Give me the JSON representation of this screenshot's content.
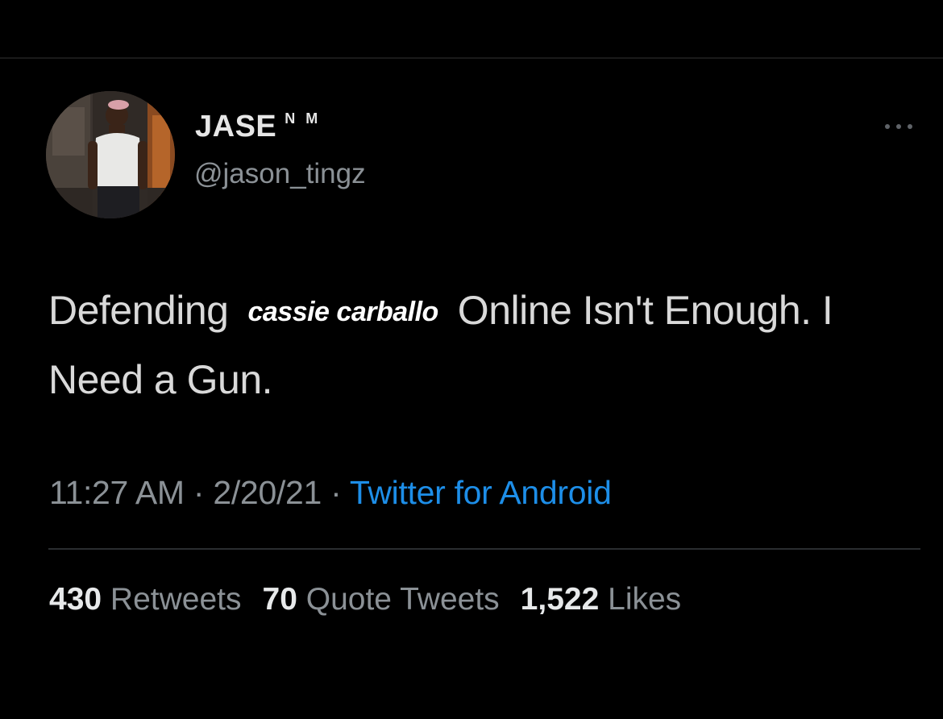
{
  "tweet": {
    "author": {
      "display_name": "JASE",
      "name_suffix": "N M",
      "handle": "@jason_tingz"
    },
    "more_icon": "more-horizontal-icon",
    "text": {
      "part1": "Defending",
      "mention": "cassie carballo",
      "part2": "Online Isn't Enough. I Need a Gun."
    },
    "time": "11:27 AM",
    "date": "2/20/21",
    "separator": "·",
    "source": "Twitter for Android",
    "stats": {
      "retweets_count": "430",
      "retweets_label": "Retweets",
      "quotes_count": "70",
      "quotes_label": "Quote Tweets",
      "likes_count": "1,522",
      "likes_label": "Likes"
    }
  },
  "colors": {
    "background": "#000000",
    "primary_text": "#e7e9ea",
    "secondary_text": "#8b9196",
    "link": "#1d8ee8"
  }
}
